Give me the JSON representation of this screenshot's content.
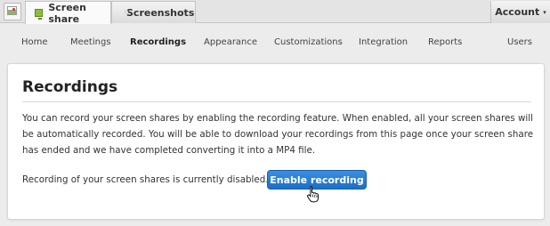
{
  "tabs": [
    {
      "label": "Screen share",
      "icon": "monitor-icon",
      "active": true
    },
    {
      "label": "Screenshots",
      "icon": "camera-icon",
      "active": false
    }
  ],
  "account": {
    "label": "Account",
    "caret": "▾"
  },
  "nav": [
    {
      "label": "Home"
    },
    {
      "label": "Meetings"
    },
    {
      "label": "Recordings",
      "active": true
    },
    {
      "label": "Appearance"
    },
    {
      "label": "Customizations"
    },
    {
      "label": "Integration"
    },
    {
      "label": "Reports"
    },
    {
      "label": "Users"
    }
  ],
  "page": {
    "title": "Recordings",
    "description": "You can record your screen shares by enabling the recording feature. When enabled, all your screen shares will be automatically recorded. You will be able to download your recordings from this page once your screen share has ended and we have completed converting it into a MP4 file.",
    "status": "Recording of your screen shares is currently disabled.",
    "button_label": "Enable recording"
  },
  "colors": {
    "accent": "#1d6fc5",
    "active_tab_icon": "#8bbf3b"
  }
}
